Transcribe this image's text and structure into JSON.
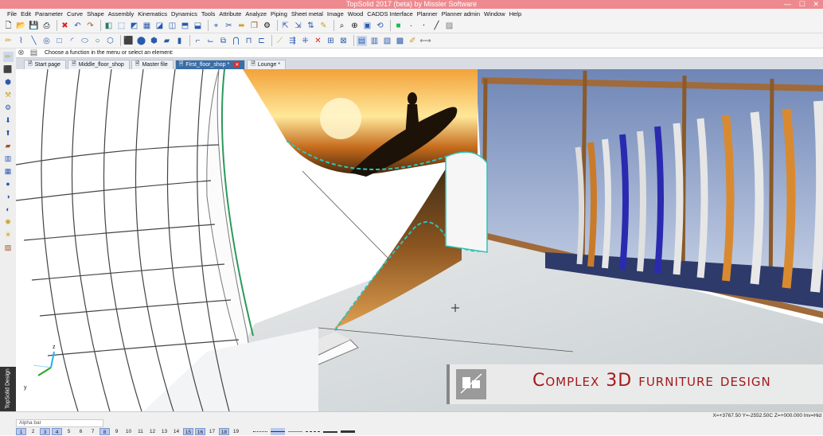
{
  "window": {
    "title": "TopSolid 2017 (beta) by Missler Software",
    "minimize": "—",
    "maximize": "☐",
    "close": "✕"
  },
  "menu": [
    "File",
    "Edit",
    "Parameter",
    "Curve",
    "Shape",
    "Assembly",
    "Kinematics",
    "Dynamics",
    "Tools",
    "Attribute",
    "Analyze",
    "Piping",
    "Sheet metal",
    "Image",
    "Wood",
    "CADDS Interface",
    "Planner",
    "Planner admin",
    "Window",
    "Help"
  ],
  "command_prompt": "Choose a function in the menu or select an element:",
  "tabs": [
    {
      "label": "Start page",
      "active": false
    },
    {
      "label": "Middle_floor_shop",
      "active": false
    },
    {
      "label": "Master file",
      "active": false
    },
    {
      "label": "First_floor_shop *",
      "active": true
    },
    {
      "label": "Lounge *",
      "active": false
    }
  ],
  "brand": "TopSolid Design",
  "axes": {
    "z": "z",
    "y": "y"
  },
  "caption": "Complex 3D furniture design",
  "status": {
    "alpha_bar": "Alpha bar",
    "coords": "X=+3767.50  Y=-2552.50C  Z=+000.000  Inv=Hid",
    "layers": [
      "1",
      "2",
      "3",
      "4",
      "5",
      "6",
      "7",
      "8",
      "9",
      "10",
      "11",
      "12",
      "13",
      "14",
      "15",
      "16",
      "17",
      "18",
      "19"
    ],
    "active_layers": [
      "1",
      "3",
      "4",
      "8",
      "15",
      "16",
      "18"
    ]
  },
  "colors": {
    "titlebar": "#ee8a8f",
    "caption_text": "#a21a1a",
    "selection": "#2ec4b6",
    "active_tab": "#3a6ea5"
  }
}
